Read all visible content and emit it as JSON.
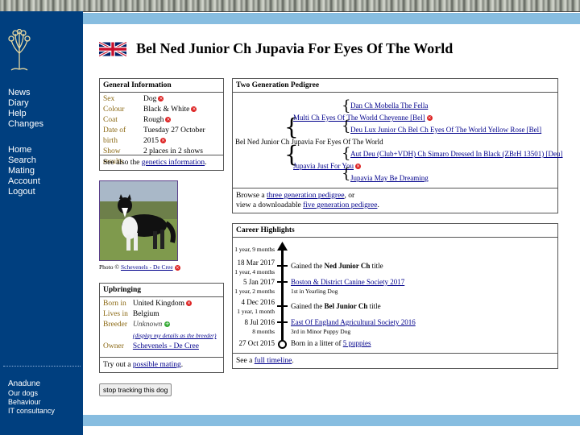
{
  "sidebar": {
    "nav_main": [
      "News",
      "Diary",
      "Help",
      "Changes"
    ],
    "nav_account": [
      "Home",
      "Search",
      "Mating",
      "Account",
      "Logout"
    ],
    "footer_head": "Anadune",
    "footer_items": [
      "Our dogs",
      "Behaviour",
      "IT consultancy"
    ]
  },
  "page_title": "Bel Ned Junior Ch Jupavia For Eyes Of The World",
  "general": {
    "heading": "General Information",
    "rows": [
      {
        "k": "Sex",
        "v": "Dog"
      },
      {
        "k": "Colour",
        "v": "Black & White"
      },
      {
        "k": "Coat",
        "v": "Rough"
      },
      {
        "k": "Date of birth",
        "v": "Tuesday 27 October 2015"
      },
      {
        "k": "Show results",
        "v": "2 places in 2 shows"
      }
    ],
    "footer_pre": "See also the ",
    "footer_link": "genetics information",
    "footer_post": "."
  },
  "photo": {
    "caption_pre": "Photo © ",
    "caption_link": "Schevenels - De Cree"
  },
  "upbringing": {
    "heading": "Upbringing",
    "born_in_k": "Born in",
    "born_in_v": "United Kingdom",
    "lives_in_k": "Lives in",
    "lives_in_v": "Belgium",
    "breeder_k": "Breeder",
    "breeder_v": "Unknown",
    "breeder_link": "(display my details as the breeder)",
    "owner_k": "Owner",
    "owner_v": "Schevenels - De Cree",
    "footer_pre": "Try out a ",
    "footer_link": "possible mating",
    "footer_post": "."
  },
  "pedigree": {
    "heading": "Two Generation Pedigree",
    "subject": "Bel Ned Junior Ch Jupavia For Eyes Of The World",
    "sire": "Multi Ch Eyes Of The World Cheyenne [Bel]",
    "sire_sire": "Dan Ch Mobella The Fella",
    "sire_dam": "Deu Lux Junior Ch Bel Ch Eyes Of The World Yellow Rose [Bel]",
    "dam": "Jupavia Just For You",
    "dam_sire": "Aut Deu (Club+VDH) Ch Simaro Dressed In Black (ZBrH 13501) [Deu]",
    "dam_dam": "Jupavia May Be Dreaming",
    "footer1_pre": "Browse a ",
    "footer1_link": "three generation pedigree",
    "footer1_post": ", or",
    "footer2_pre": "view a downloadable ",
    "footer2_link": "five generation pedigree",
    "footer2_post": "."
  },
  "career": {
    "heading": "Career Highlights",
    "top_age": "1 year, 9 months",
    "events": [
      {
        "date": "18 Mar 2017",
        "age_after": "1 year, 4 months",
        "text_pre": "Gained the ",
        "text_bold": "Ned Junior Ch",
        "text_post": " title"
      },
      {
        "date": "5 Jan 2017",
        "age_after": "1 year, 2 months",
        "link": "Boston & District Canine Society 2017",
        "sub": "1st in Yearling Dog"
      },
      {
        "date": "4 Dec 2016",
        "age_after": "1 year, 1 month",
        "text_pre": "Gained the ",
        "text_bold": "Bel Junior Ch",
        "text_post": " title"
      },
      {
        "date": "8 Jul 2016",
        "age_after": "8 months",
        "link": "East Of England Agricultural Society 2016",
        "sub": "3rd in Minor Puppy Dog"
      },
      {
        "date": "27 Oct 2015",
        "text_pre": "Born in a litter of ",
        "link": "5 puppies"
      }
    ],
    "footer_pre": "See a ",
    "footer_link": "full timeline",
    "footer_post": "."
  },
  "stop_button": "stop tracking this dog"
}
